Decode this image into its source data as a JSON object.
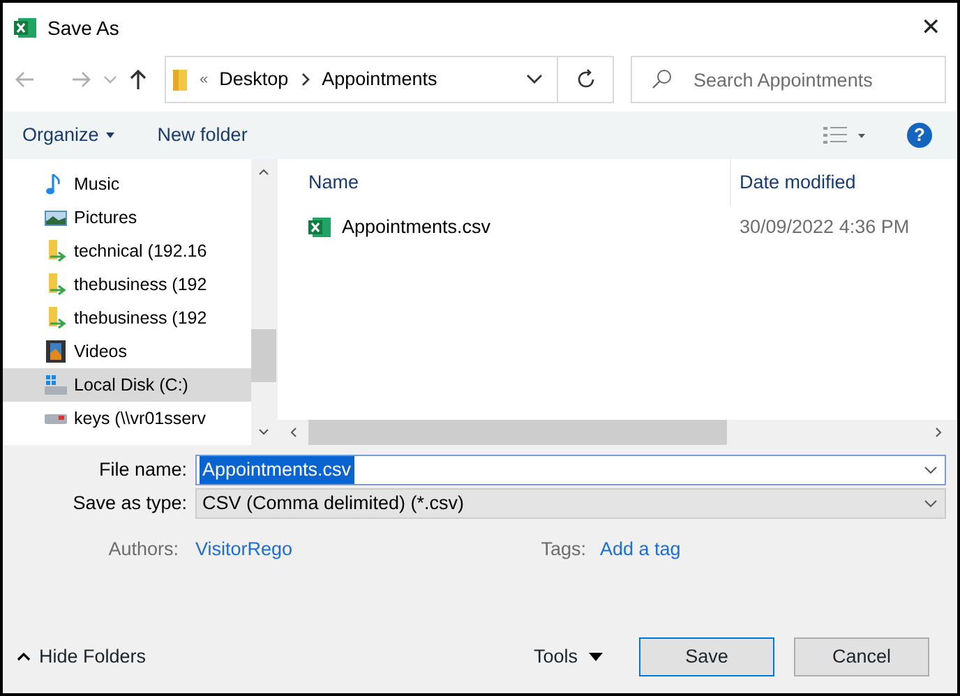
{
  "window": {
    "title": "Save As",
    "close": "✕"
  },
  "nav": {
    "path": [
      "Desktop",
      "Appointments"
    ],
    "overflow": "«",
    "search": {
      "placeholder": "Search Appointments"
    }
  },
  "toolbar": {
    "organize": "Organize",
    "new_folder": "New folder",
    "help": "?"
  },
  "sidebar": {
    "items": [
      {
        "label": "Music",
        "kind": "music",
        "selected": false
      },
      {
        "label": "Pictures",
        "kind": "pictures",
        "selected": false
      },
      {
        "label": "technical (192.16",
        "kind": "share",
        "selected": false
      },
      {
        "label": "thebusiness (192",
        "kind": "share",
        "selected": false
      },
      {
        "label": "thebusiness (192",
        "kind": "share",
        "selected": false
      },
      {
        "label": "Videos",
        "kind": "videos",
        "selected": false
      },
      {
        "label": "Local Disk (C:)",
        "kind": "disk",
        "selected": true
      },
      {
        "label": "keys (\\\\vr01sserv",
        "kind": "netdrive",
        "selected": false
      }
    ]
  },
  "file_list": {
    "columns": [
      "Name",
      "Date modified"
    ],
    "rows": [
      {
        "name": "Appointments.csv",
        "date_modified": "30/09/2022 4:36 PM"
      }
    ]
  },
  "form": {
    "file_name_label": "File name:",
    "file_name": "Appointments.csv",
    "type_label": "Save as type:",
    "type": "CSV (Comma delimited) (*.csv)",
    "authors_label": "Authors:",
    "authors": "VisitorRego",
    "tags_label": "Tags:",
    "tags": "Add a tag"
  },
  "footer": {
    "hide_folders": "Hide Folders",
    "tools": "Tools",
    "save": "Save",
    "cancel": "Cancel"
  }
}
